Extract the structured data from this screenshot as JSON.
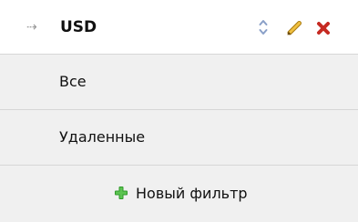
{
  "filters": {
    "active": {
      "arrow": "⇢",
      "label": "USD",
      "icons": {
        "sort": "sort-updown-icon",
        "edit": "pencil-icon",
        "delete": "close-x-icon"
      }
    },
    "items": [
      {
        "label": "Все"
      },
      {
        "label": "Удаленные"
      }
    ],
    "new_filter": {
      "icon": "plus-icon",
      "label": "Новый фильтр"
    }
  },
  "colors": {
    "row_bg": "#f0f0f0",
    "divider": "#d6d6d6",
    "sort_icon": "#8aa0c8",
    "edit_icon": "#d9a21a",
    "delete_icon": "#c62a22",
    "plus_icon": "#2f9a2a"
  }
}
